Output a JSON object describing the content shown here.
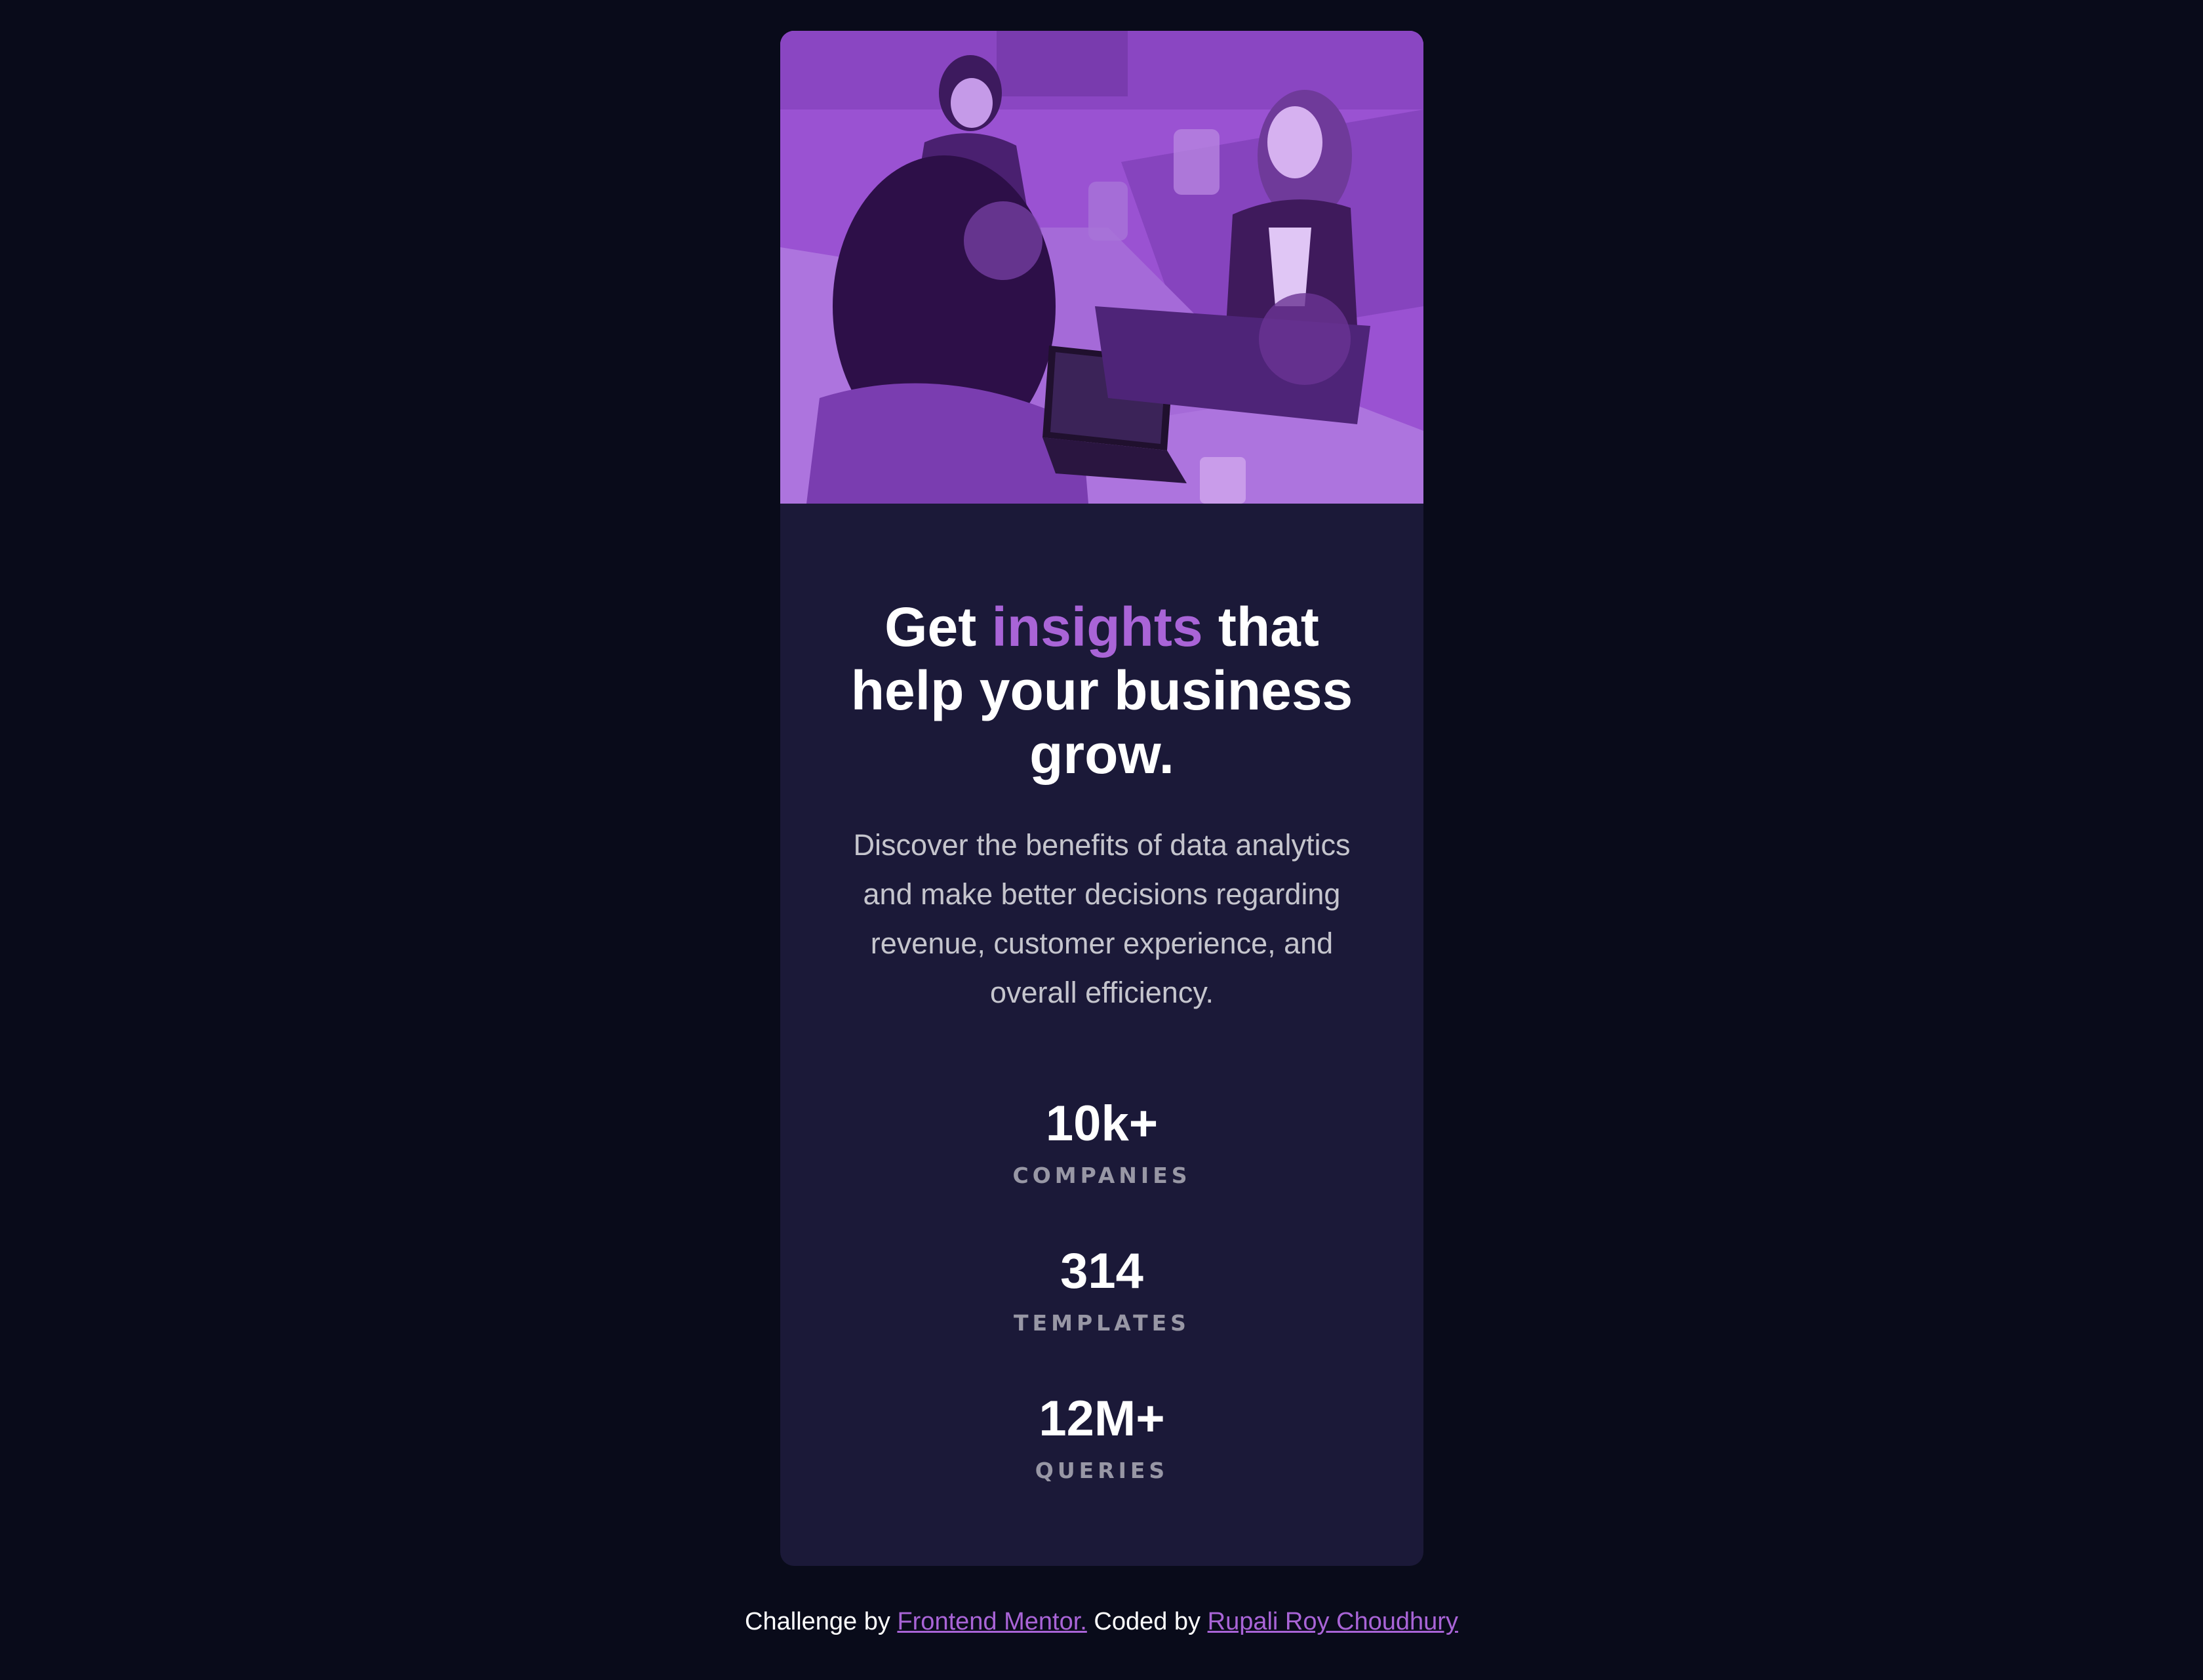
{
  "card": {
    "heading": {
      "part1": "Get ",
      "accent": "insights",
      "part2": " that help your business grow."
    },
    "description": "Discover the benefits of data analytics and make better decisions regarding revenue, customer experience, and overall efficiency.",
    "stats": [
      {
        "value": "10k+",
        "label": "COMPANIES"
      },
      {
        "value": "314",
        "label": "TEMPLATES"
      },
      {
        "value": "12M+",
        "label": "QUERIES"
      }
    ]
  },
  "attribution": {
    "prefix": "Challenge by ",
    "link1": "Frontend Mentor.",
    "middle": " Coded by ",
    "link2": "Rupali Roy Choudhury"
  },
  "colors": {
    "background": "#090b1a",
    "card": "#1b1938",
    "accent": "#a964d7",
    "image_overlay": "#9b4fd4"
  }
}
